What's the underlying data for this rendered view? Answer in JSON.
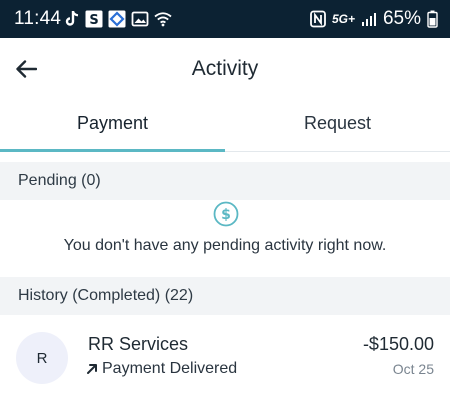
{
  "status_bar": {
    "time": "11:44",
    "network": "5G+",
    "battery": "65%",
    "left_icons": [
      "tiktok-icon",
      "s-app-icon",
      "diamond-app-icon",
      "gallery-icon",
      "wifi-icon"
    ],
    "right_icons": [
      "nfc-icon",
      "signal-icon",
      "battery-icon"
    ]
  },
  "header": {
    "title": "Activity"
  },
  "tabs": [
    {
      "label": "Payment",
      "active": true
    },
    {
      "label": "Request",
      "active": false
    }
  ],
  "pending": {
    "header": "Pending (0)",
    "empty_message": "You don't have any pending activity right now."
  },
  "history": {
    "header": "History (Completed) (22)",
    "items": [
      {
        "initial": "R",
        "name": "RR Services",
        "status": "Payment Delivered",
        "amount": "-$150.00",
        "date": "Oct 25"
      }
    ]
  },
  "colors": {
    "status_bar": "#0c2233",
    "accent": "#5bb8c4",
    "section_bg": "#f2f4f6",
    "avatar_bg": "#eef0fa"
  }
}
